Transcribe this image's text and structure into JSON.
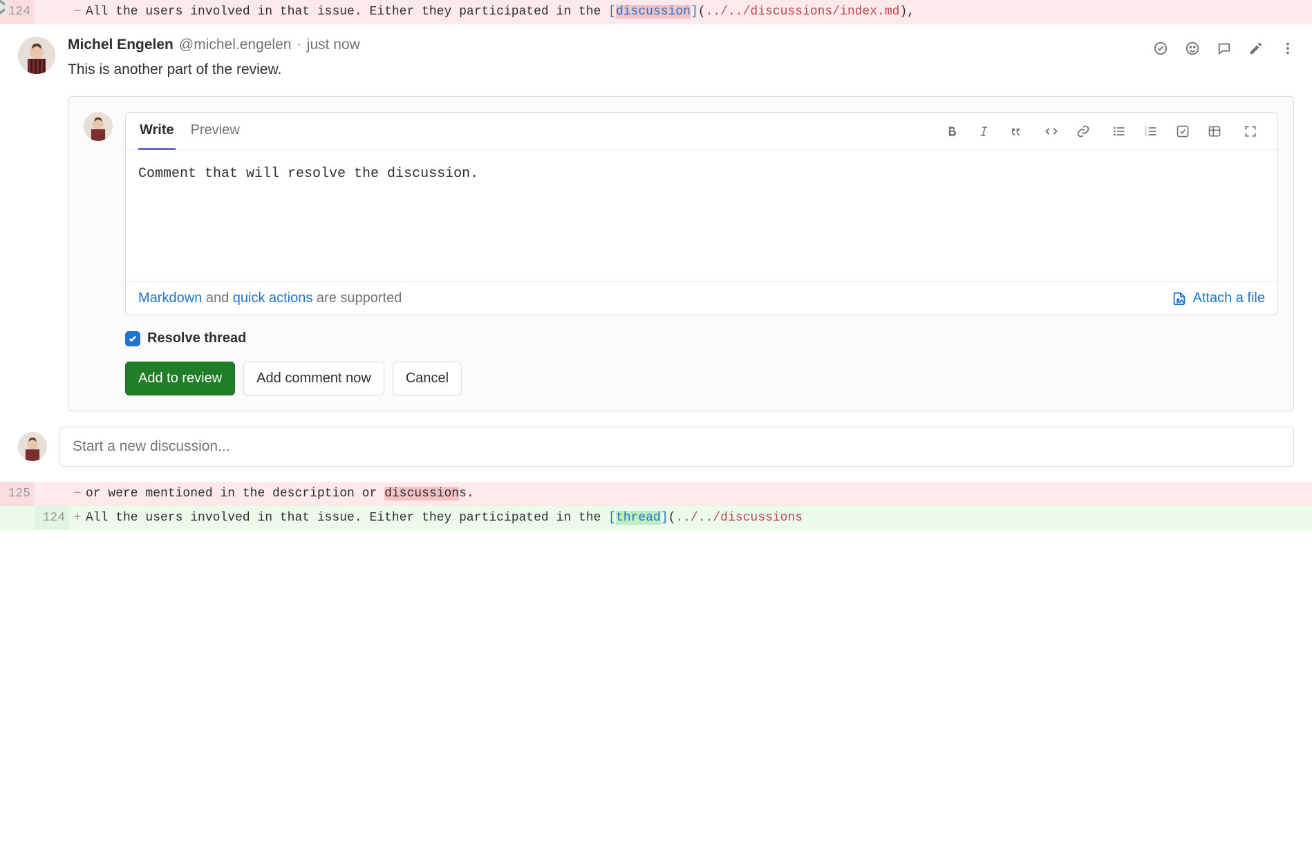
{
  "diff_rows": [
    {
      "type": "del",
      "old_line": "124",
      "new_line": "",
      "sign": "−",
      "segments": [
        {
          "t": "All the users involved in that issue. Either they participated in the ",
          "cls": ""
        },
        {
          "t": "[",
          "cls": "token-link"
        },
        {
          "t": "discussion",
          "cls": "token-link hl-del"
        },
        {
          "t": "]",
          "cls": "token-link"
        },
        {
          "t": "(",
          "cls": ""
        },
        {
          "t": "../../discussions/index.md",
          "cls": "token-path"
        },
        {
          "t": ")",
          "cls": ""
        },
        {
          "t": ",",
          "cls": ""
        }
      ]
    }
  ],
  "comment": {
    "author_name": "Michel Engelen",
    "author_handle": "@michel.engelen",
    "time": "just now",
    "body": "This is another part of the review."
  },
  "editor": {
    "tabs": {
      "write": "Write",
      "preview": "Preview"
    },
    "value": "Comment that will resolve the discussion.",
    "footer": {
      "markdown": "Markdown",
      "and": " and ",
      "quick_actions": "quick actions",
      "supported": " are supported",
      "attach": "Attach a file"
    },
    "resolve_label": "Resolve thread",
    "resolve_checked": true,
    "buttons": {
      "add_review": "Add to review",
      "add_now": "Add comment now",
      "cancel": "Cancel"
    }
  },
  "new_discussion_placeholder": "Start a new discussion...",
  "trailing_rows": [
    {
      "type": "del",
      "old_line": "125",
      "new_line": "",
      "sign": "−",
      "segments": [
        {
          "t": "or were mentioned in the description or ",
          "cls": ""
        },
        {
          "t": "discussion",
          "cls": "hl-del"
        },
        {
          "t": "s.",
          "cls": ""
        }
      ]
    },
    {
      "type": "add",
      "old_line": "",
      "new_line": "124",
      "sign": "+",
      "segments": [
        {
          "t": "All the users involved in that issue. Either they participated in the ",
          "cls": ""
        },
        {
          "t": "[",
          "cls": "token-link"
        },
        {
          "t": "thread",
          "cls": "token-link hl-add"
        },
        {
          "t": "]",
          "cls": "token-link"
        },
        {
          "t": "(",
          "cls": ""
        },
        {
          "t": "../../discussions",
          "cls": "token-path"
        }
      ]
    }
  ]
}
